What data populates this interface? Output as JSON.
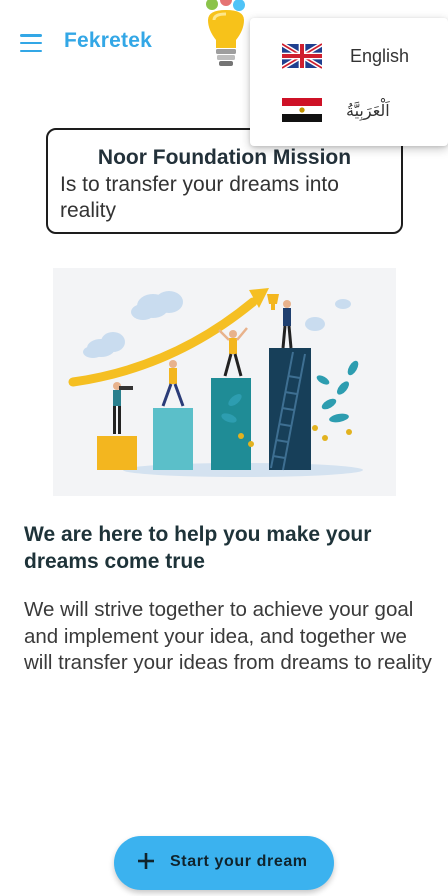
{
  "app_bar": {
    "title": "Fekretek",
    "menu_icon": "hamburger-menu-icon",
    "logo_icon": "lightbulb-logo-icon"
  },
  "language_menu": {
    "items": [
      {
        "label": "English",
        "flag": "uk-flag-icon"
      },
      {
        "label": "اَلْعَرَبِيَّةُ",
        "flag": "egypt-flag-icon"
      }
    ]
  },
  "mission": {
    "title": "Noor Foundation Mission",
    "text": "Is to transfer your dreams into reality"
  },
  "illustration": {
    "icon": "growth-chart-illustration"
  },
  "content": {
    "headline": "We are here to help you make your dreams come true",
    "body": "We will strive together to achieve your goal and implement your idea, and together we will transfer your ideas from dreams to reality"
  },
  "fab": {
    "label": "Start your dream",
    "icon": "plus-icon"
  },
  "colors": {
    "accent": "#33a7e6",
    "fab": "#3bb2ef",
    "headline": "#1e3339"
  }
}
